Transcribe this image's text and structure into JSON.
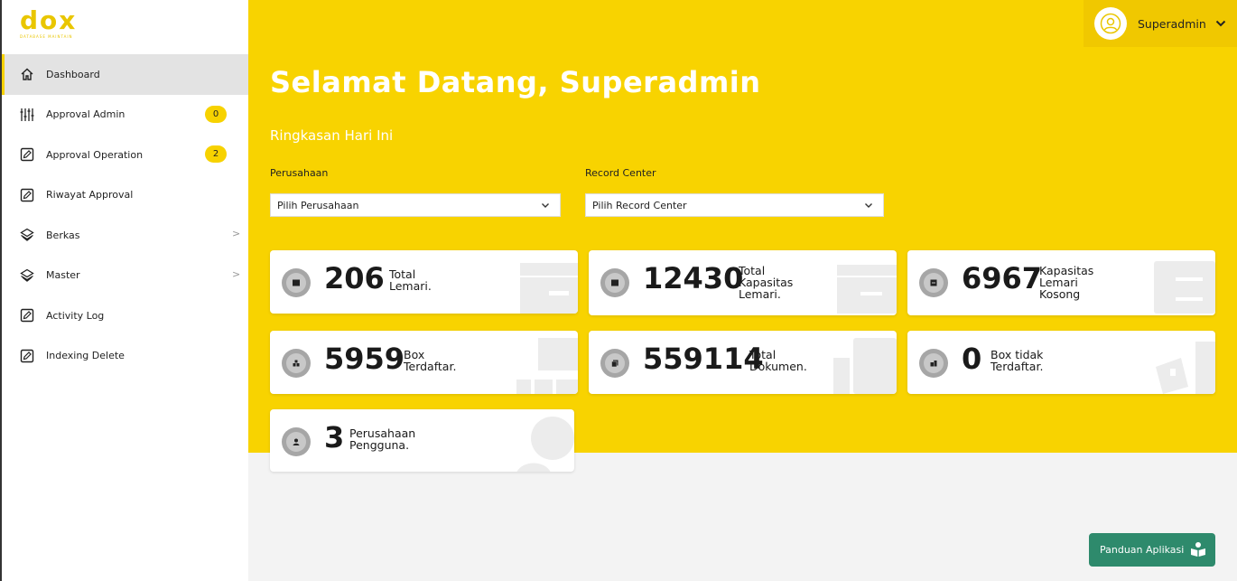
{
  "brand": {
    "logo_text": "dox",
    "tagline": "DATABASE MAINTAIN"
  },
  "sidebar": {
    "items": [
      {
        "label": "Dashboard",
        "icon": "home-icon",
        "active": true
      },
      {
        "label": "Approval Admin",
        "icon": "sliders-icon",
        "badge": "0"
      },
      {
        "label": "Approval Operation",
        "icon": "edit-icon",
        "badge": "2"
      },
      {
        "label": "Riwayat Approval",
        "icon": "edit-icon"
      },
      {
        "label": "Berkas",
        "icon": "layers-icon",
        "expand": ">"
      },
      {
        "label": "Master",
        "icon": "layers-icon",
        "expand": ">"
      },
      {
        "label": "Activity Log",
        "icon": "edit-icon"
      },
      {
        "label": "Indexing Delete",
        "icon": "edit-icon"
      }
    ]
  },
  "header": {
    "user_name": "Superadmin"
  },
  "main": {
    "welcome_prefix": "Selamat Datang,",
    "welcome_name": "Superadmin",
    "summary_title": "Ringkasan Hari Ini",
    "filters": {
      "company_label": "Perusahaan",
      "company_value": "Pilih Perusahaan",
      "record_label": "Record Center",
      "record_value": "Pilih Record Center"
    },
    "stats": [
      {
        "value": "206",
        "label_1": "Total",
        "label_2": "Lemari.",
        "label_3": ""
      },
      {
        "value": "12430",
        "label_1": "Total",
        "label_2": "Kapasitas",
        "label_3": "Lemari."
      },
      {
        "value": "6967",
        "label_1": "Kapasitas",
        "label_2": "Lemari",
        "label_3": "Kosong"
      },
      {
        "value": "5959",
        "label_1": "Box",
        "label_2": "Terdaftar.",
        "label_3": ""
      },
      {
        "value": "559114",
        "label_1": "Total",
        "label_2": "Dokumen.",
        "label_3": ""
      },
      {
        "value": "0",
        "label_1": "Box tidak",
        "label_2": "Terdaftar.",
        "label_3": ""
      },
      {
        "value": "3",
        "label_1": "Perusahaan",
        "label_2": "Pengguna.",
        "label_3": ""
      }
    ]
  },
  "help_button": {
    "label": "Panduan Aplikasi"
  },
  "colors": {
    "accent": "#f8d300",
    "help": "#2e8a6c",
    "badge": "#f7d200"
  }
}
